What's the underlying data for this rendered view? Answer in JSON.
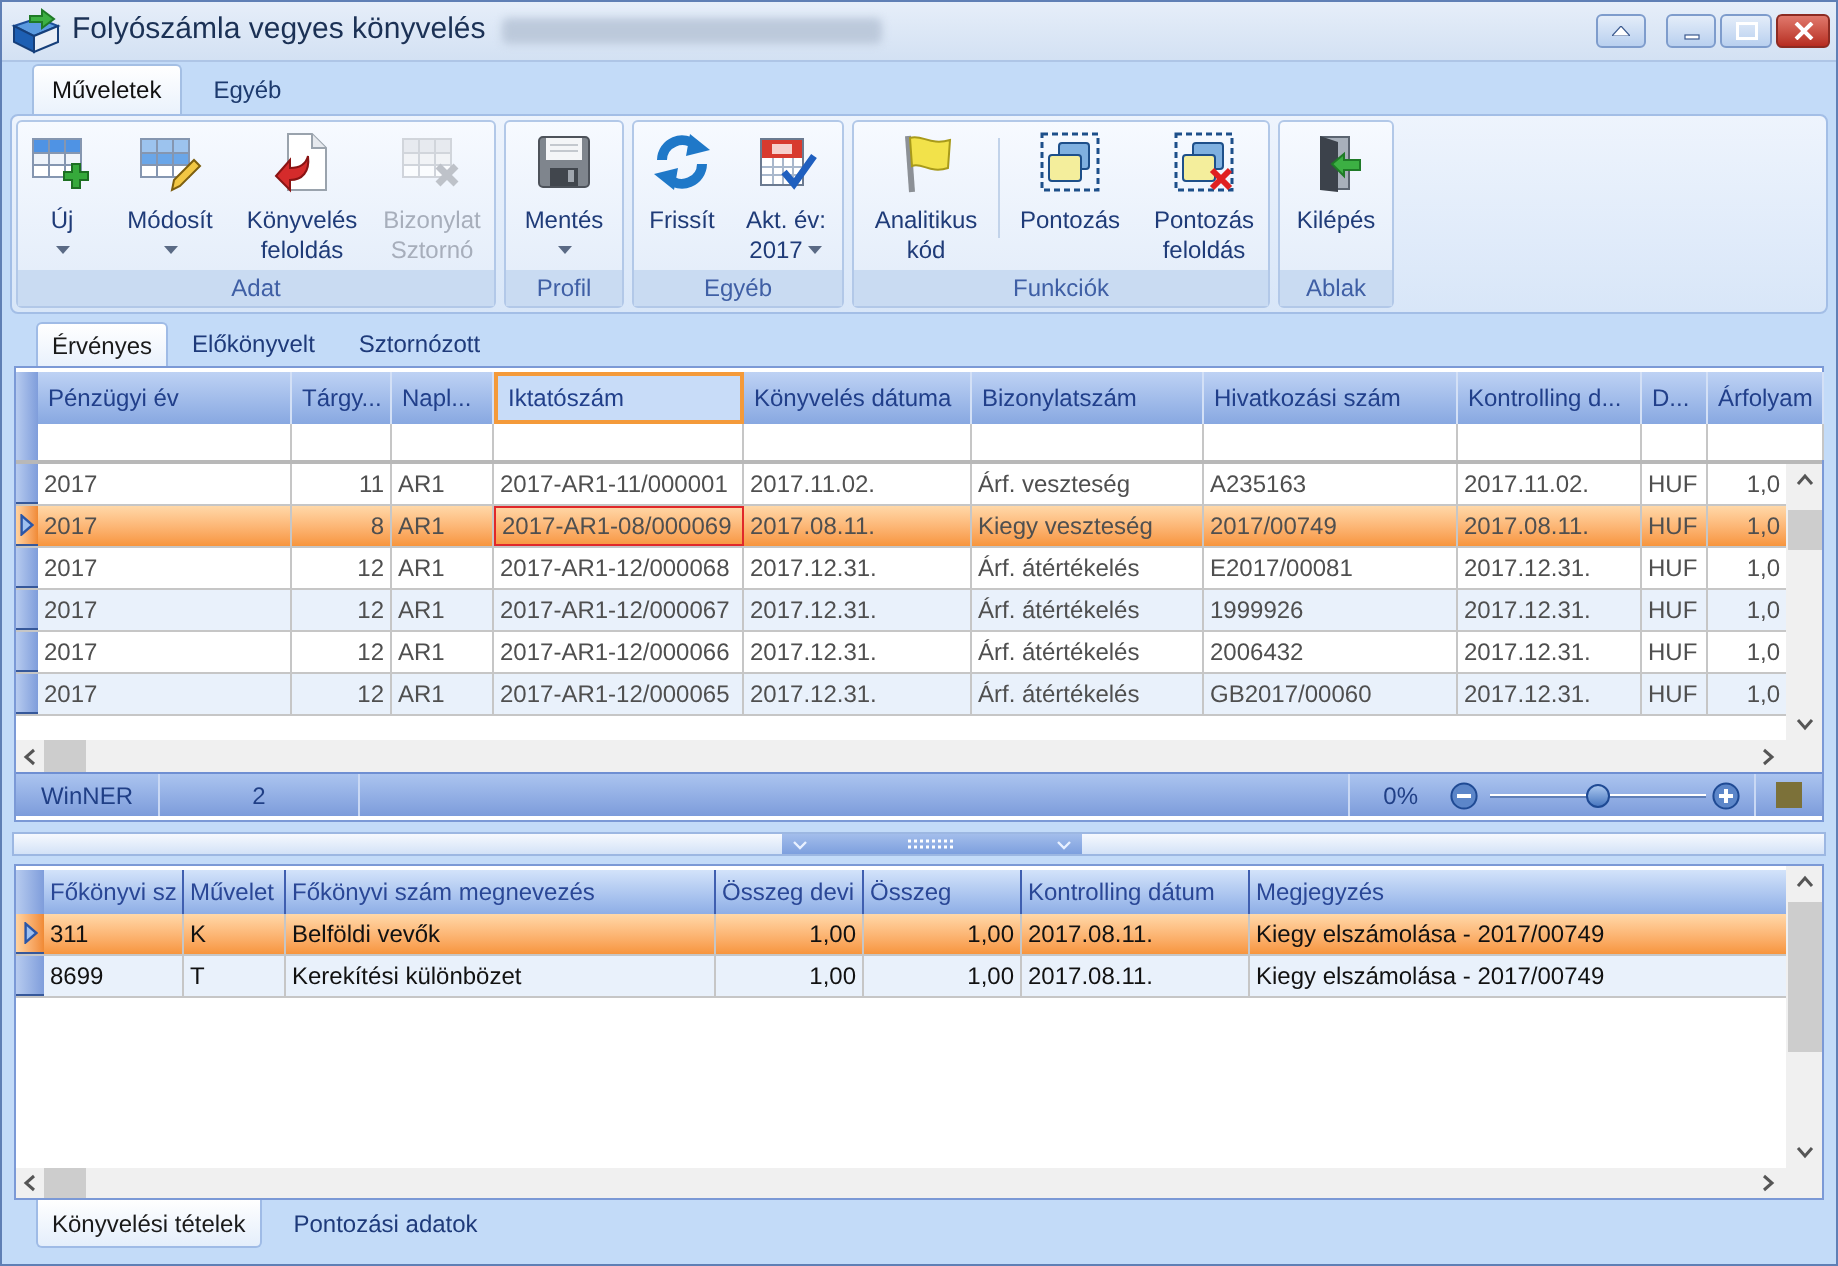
{
  "window": {
    "title": "Folyószámla vegyes könyvelés"
  },
  "ribbon": {
    "tabs": [
      {
        "label": "Műveletek",
        "selected": true
      },
      {
        "label": "Egyéb",
        "selected": false
      }
    ],
    "groups": [
      {
        "label": "Adat",
        "buttons": [
          {
            "label": "Új",
            "dropdown": true,
            "disabled": false
          },
          {
            "label": "Módosít",
            "dropdown": true,
            "disabled": false
          },
          {
            "label": "Könyvelés feloldás",
            "dropdown": false,
            "disabled": false
          },
          {
            "label": "Bizonylat Sztornó",
            "dropdown": false,
            "disabled": true
          }
        ]
      },
      {
        "label": "Profil",
        "buttons": [
          {
            "label": "Mentés",
            "dropdown": true,
            "disabled": false
          }
        ]
      },
      {
        "label": "Egyéb",
        "buttons": [
          {
            "label": "Frissít",
            "dropdown": false,
            "disabled": false
          },
          {
            "label": "Akt. év: 2017",
            "dropdown": true,
            "disabled": false
          }
        ]
      },
      {
        "label": "Funkciók",
        "buttons": [
          {
            "label": "Analitikus kód",
            "dropdown": false,
            "disabled": false
          },
          {
            "label": "Pontozás",
            "dropdown": false,
            "disabled": false
          },
          {
            "label": "Pontozás feloldás",
            "dropdown": false,
            "disabled": false
          }
        ]
      },
      {
        "label": "Ablak",
        "buttons": [
          {
            "label": "Kilépés",
            "dropdown": false,
            "disabled": false
          }
        ]
      }
    ]
  },
  "record_tabs": [
    {
      "label": "Érvényes",
      "selected": true
    },
    {
      "label": "Előkönyvelt",
      "selected": false
    },
    {
      "label": "Sztornózott",
      "selected": false
    }
  ],
  "records_table": {
    "columns": [
      {
        "label": "Pénzügyi év",
        "kind": "text",
        "focused": false
      },
      {
        "label": "Tárgy...",
        "kind": "number",
        "focused": false
      },
      {
        "label": "Napl...",
        "kind": "text",
        "focused": false
      },
      {
        "label": "Iktatószám",
        "kind": "text",
        "focused": true
      },
      {
        "label": "Könyvelés dátuma",
        "kind": "text",
        "focused": false
      },
      {
        "label": "Bizonylatszám",
        "kind": "text",
        "focused": false
      },
      {
        "label": "Hivatkozási szám",
        "kind": "text",
        "focused": false
      },
      {
        "label": "Kontrolling d...",
        "kind": "text",
        "focused": false
      },
      {
        "label": "D...",
        "kind": "text",
        "focused": false
      },
      {
        "label": "Árfolyam",
        "kind": "number",
        "focused": false
      }
    ],
    "rows": [
      {
        "selected": false,
        "cells": [
          "2017",
          "11",
          "AR1",
          "2017-AR1-11/000001",
          "2017.11.02.",
          "Árf. veszteség",
          "A235163",
          "2017.11.02.",
          "HUF",
          "1,0"
        ]
      },
      {
        "selected": true,
        "cells": [
          "2017",
          "8",
          "AR1",
          "2017-AR1-08/000069",
          "2017.08.11.",
          "Kiegy veszteség",
          "2017/00749",
          "2017.08.11.",
          "HUF",
          "1,0"
        ]
      },
      {
        "selected": false,
        "cells": [
          "2017",
          "12",
          "AR1",
          "2017-AR1-12/000068",
          "2017.12.31.",
          "Árf. átértékelés",
          "E2017/00081",
          "2017.12.31.",
          "HUF",
          "1,0"
        ]
      },
      {
        "selected": false,
        "cells": [
          "2017",
          "12",
          "AR1",
          "2017-AR1-12/000067",
          "2017.12.31.",
          "Árf. átértékelés",
          "1999926",
          "2017.12.31.",
          "HUF",
          "1,0"
        ]
      },
      {
        "selected": false,
        "cells": [
          "2017",
          "12",
          "AR1",
          "2017-AR1-12/000066",
          "2017.12.31.",
          "Árf. átértékelés",
          "2006432",
          "2017.12.31.",
          "HUF",
          "1,0"
        ]
      },
      {
        "selected": false,
        "cells": [
          "2017",
          "12",
          "AR1",
          "2017-AR1-12/000065",
          "2017.12.31.",
          "Árf. átértékelés",
          "GB2017/00060",
          "2017.12.31.",
          "HUF",
          "1,0"
        ]
      }
    ]
  },
  "status_bar": {
    "cells": [
      "WinNER",
      "2"
    ],
    "zoom": {
      "reading": "0%",
      "level": 0.5
    }
  },
  "entries_table": {
    "columns": [
      {
        "label": "Főkönyvi sz",
        "kind": "text"
      },
      {
        "label": "Művelet",
        "kind": "text"
      },
      {
        "label": "Főkönyvi szám megnevezés",
        "kind": "text"
      },
      {
        "label": "Összeg devi",
        "kind": "number"
      },
      {
        "label": "Összeg",
        "kind": "number"
      },
      {
        "label": "Kontrolling dátum",
        "kind": "text"
      },
      {
        "label": "Megjegyzés",
        "kind": "text"
      }
    ],
    "rows": [
      {
        "selected": true,
        "cells": [
          "311",
          "K",
          "Belföldi vevők",
          "1,00",
          "1,00",
          "2017.08.11.",
          "Kiegy elszámolása - 2017/00749"
        ]
      },
      {
        "selected": false,
        "cells": [
          "8699",
          "T",
          "Kerekítési különbözet",
          "1,00",
          "1,00",
          "2017.08.11.",
          "Kiegy elszámolása - 2017/00749"
        ]
      }
    ]
  },
  "detail_tabs": [
    {
      "label": "Könyvelési tételek",
      "selected": true
    },
    {
      "label": "Pontozási adatok",
      "selected": false
    }
  ]
}
